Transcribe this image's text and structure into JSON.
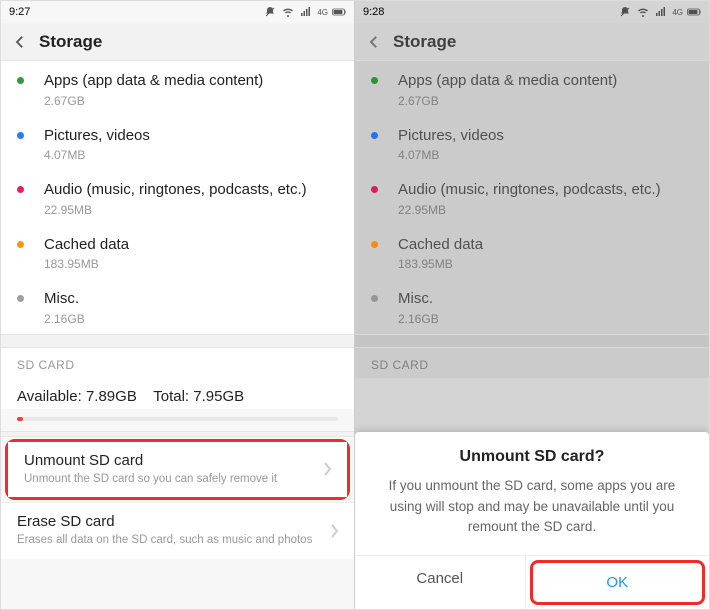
{
  "left": {
    "time": "9:27",
    "header": "Storage",
    "items": [
      {
        "title": "Apps (app data & media content)",
        "sub": "2.67GB",
        "dot": "#2e9a3a"
      },
      {
        "title": "Pictures, videos",
        "sub": "4.07MB",
        "dot": "#2979ff"
      },
      {
        "title": "Audio (music, ringtones, podcasts, etc.)",
        "sub": "22.95MB",
        "dot": "#e91e63"
      },
      {
        "title": "Cached data",
        "sub": "183.95MB",
        "dot": "#ff9800"
      },
      {
        "title": "Misc.",
        "sub": "2.16GB",
        "dot": "#9e9e9e"
      }
    ],
    "sd_header": "SD CARD",
    "sd_available_label": "Available:",
    "sd_available": "7.89GB",
    "sd_total_label": "Total:",
    "sd_total": "7.95GB",
    "unmount": {
      "title": "Unmount SD card",
      "sub": "Unmount the SD card so you can safely remove it"
    },
    "erase": {
      "title": "Erase SD card",
      "sub": "Erases all data on the SD card, such as music and photos"
    }
  },
  "right": {
    "time": "9:28",
    "header": "Storage",
    "items": [
      {
        "title": "Apps (app data & media content)",
        "sub": "2.67GB",
        "dot": "#2e9a3a"
      },
      {
        "title": "Pictures, videos",
        "sub": "4.07MB",
        "dot": "#2979ff"
      },
      {
        "title": "Audio (music, ringtones, podcasts, etc.)",
        "sub": "22.95MB",
        "dot": "#e91e63"
      },
      {
        "title": "Cached data",
        "sub": "183.95MB",
        "dot": "#ff9800"
      },
      {
        "title": "Misc.",
        "sub": "2.16GB",
        "dot": "#9e9e9e"
      }
    ],
    "sd_header": "SD CARD",
    "dialog": {
      "title": "Unmount SD card?",
      "message": "If you unmount the SD card, some apps you are using will stop and may be unavailable until you remount the SD card.",
      "cancel": "Cancel",
      "ok": "OK"
    }
  }
}
